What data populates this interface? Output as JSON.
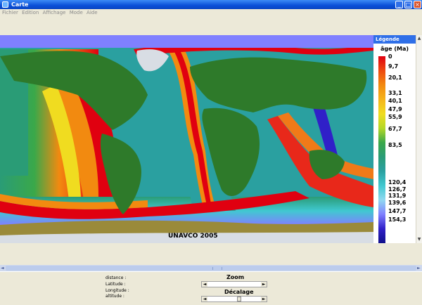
{
  "window": {
    "title": "Carte",
    "minimize_glyph": "_",
    "maximize_glyph": "□",
    "close_glyph": "×"
  },
  "menu": {
    "items": [
      "Fichier",
      "Edition",
      "Affichage",
      "Mode",
      "Aide"
    ]
  },
  "map": {
    "credit": "UNAVCO 2005",
    "colors": {
      "ocean_deep": "#1b2a8c",
      "land": "#2e7a2a",
      "ice": "#d8dde4",
      "ridge_red": "#e8281a",
      "ridge_orange": "#f07a18",
      "ridge_yellow": "#e8d020",
      "mid_green": "#2a9a72"
    }
  },
  "legend": {
    "title": "Légende",
    "unit_label": "âge (Ma)",
    "labels": [
      "0",
      "9,7",
      "20,1",
      "33,1",
      "40,1",
      "47,9",
      "55,9",
      "67,7",
      "83,5",
      "120,4",
      "126,7",
      "131,9",
      "139,6",
      "147,7",
      "154,3"
    ],
    "stops": [
      {
        "color": "#e00010"
      },
      {
        "color": "#ee4a10"
      },
      {
        "color": "#f28a10"
      },
      {
        "color": "#f5b41a"
      },
      {
        "color": "#f0dc20"
      },
      {
        "color": "#b4d828"
      },
      {
        "color": "#3aa84a"
      },
      {
        "color": "#2a9c76"
      },
      {
        "color": "#2aa0a0"
      },
      {
        "color": "#40c8d0"
      },
      {
        "color": "#90d8f0"
      },
      {
        "color": "#8080ff"
      },
      {
        "color": "#3020c8"
      },
      {
        "color": "#10108a"
      }
    ]
  },
  "scroll": {
    "up_glyph": "▲",
    "down_glyph": "▼",
    "left_glyph": "◄",
    "right_glyph": "►"
  },
  "status": {
    "distance_label": "distance :",
    "latitude_label": "Latitude :",
    "longitude_label": "Longitude :",
    "altitude_label": "altitude :",
    "zoom_title": "Zoom",
    "decalage_title": "Décalage",
    "slider_left_glyph": "◄",
    "slider_right_glyph": "►"
  }
}
